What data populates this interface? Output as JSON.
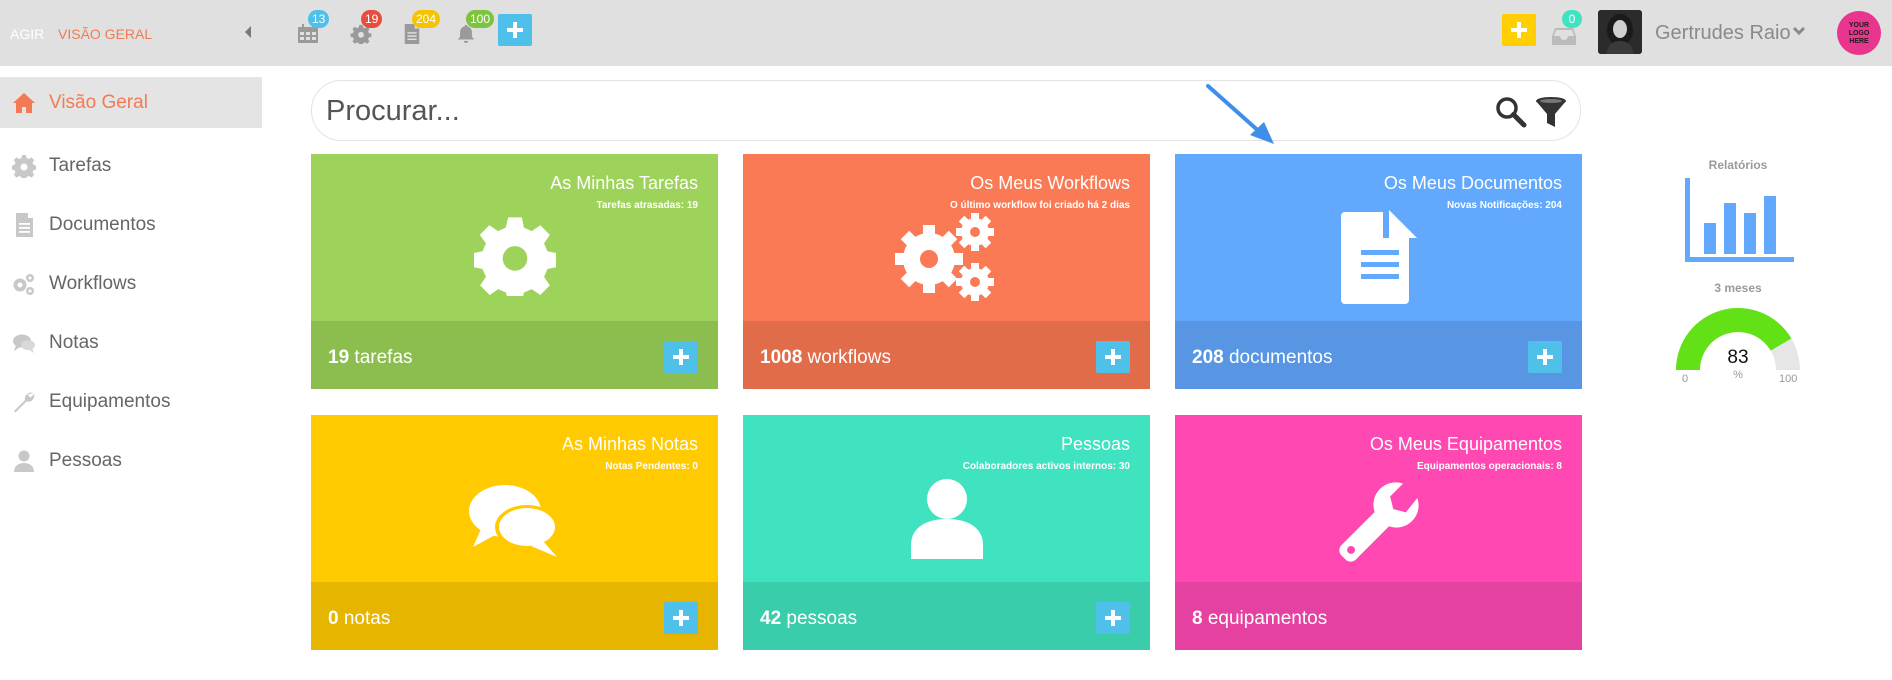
{
  "breadcrumb": {
    "root": "AGIR",
    "current": "VISÃO GERAL"
  },
  "topbar": {
    "badges": [
      {
        "icon": "calendar-icon",
        "count": "13",
        "color": "#4fc0ea"
      },
      {
        "icon": "gear-icon",
        "count": "19",
        "color": "#e84c3d"
      },
      {
        "icon": "document-icon",
        "count": "204",
        "color": "#f5c400"
      },
      {
        "icon": "bell-icon",
        "count": "100",
        "color": "#7cc33e"
      }
    ],
    "inbox_count": "0",
    "user_name": "Gertrudes Raio",
    "logo_text": "YOUR LOGO HERE"
  },
  "sidebar": {
    "items": [
      {
        "label": "Visão Geral",
        "icon": "home-icon",
        "active": true
      },
      {
        "label": "Tarefas",
        "icon": "gear-icon"
      },
      {
        "label": "Documentos",
        "icon": "document-icon"
      },
      {
        "label": "Workflows",
        "icon": "gears-icon"
      },
      {
        "label": "Notas",
        "icon": "chat-icon"
      },
      {
        "label": "Equipamentos",
        "icon": "wrench-icon"
      },
      {
        "label": "Pessoas",
        "icon": "person-icon"
      }
    ]
  },
  "search": {
    "placeholder": "Procurar..."
  },
  "tiles": [
    {
      "title": "As Minhas Tarefas",
      "subtitle": "Tarefas atrasadas: 19",
      "count": "19",
      "unit": " tarefas",
      "icon": "gear-icon",
      "color": "#9dd35a",
      "footer_color": "#8bbd4f"
    },
    {
      "title": "Os Meus Workflows",
      "subtitle": "O último workflow foi criado há 2 dias",
      "count": "1008",
      "unit": " workflows",
      "icon": "gears-icon",
      "color": "#f97a54",
      "footer_color": "#e16c4a"
    },
    {
      "title": "Os Meus Documentos",
      "subtitle": "Novas Notificações: 204",
      "count": "208",
      "unit": " documentos",
      "icon": "document-icon",
      "color": "#62a8fd",
      "footer_color": "#5896e3"
    },
    {
      "title": "As Minhas Notas",
      "subtitle": "Notas Pendentes: 0",
      "count": "0",
      "unit": " notas",
      "icon": "chat-icon",
      "color": "#ffca00",
      "footer_color": "#e6b500"
    },
    {
      "title": "Pessoas",
      "subtitle": "Colaboradores activos internos: 30",
      "count": "42",
      "unit": " pessoas",
      "icon": "person-icon",
      "color": "#40e3bf",
      "footer_color": "#39cdab"
    },
    {
      "title": "Os Meus Equipamentos",
      "subtitle": "Equipamentos operacionais: 8",
      "count": "8",
      "unit": " equipamentos",
      "icon": "wrench-icon",
      "color": "#ff48b2",
      "footer_color": "#e541a0"
    }
  ],
  "reports": {
    "title": "Relatórios",
    "period": "3 meses",
    "gauge": {
      "value": "83",
      "unit": "%",
      "min": "0",
      "max": "100",
      "fraction": 0.83
    }
  }
}
